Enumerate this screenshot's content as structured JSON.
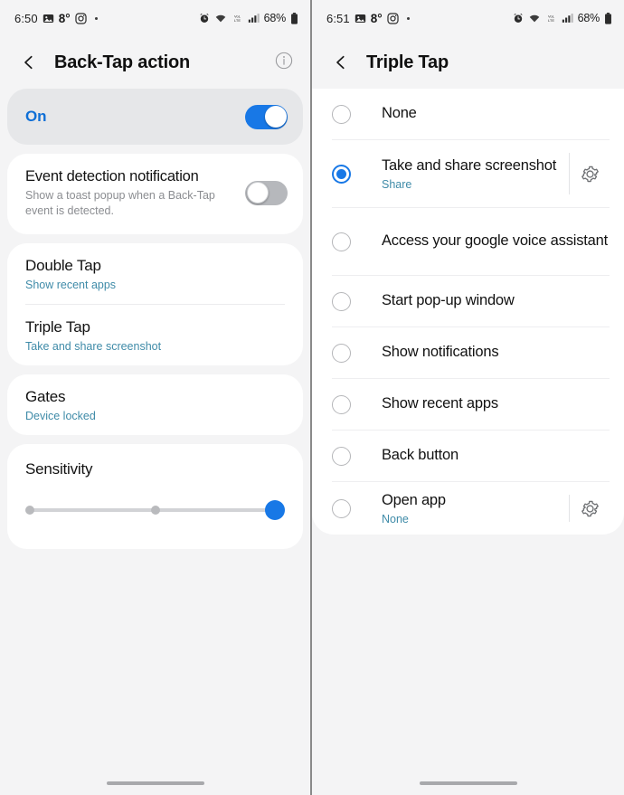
{
  "screens": [
    {
      "status_bar": {
        "time": "6:50",
        "temperature": "8°",
        "icons_left": [
          "photo-icon",
          "instagram-icon",
          "dot-indicator"
        ],
        "icons_right": [
          "alarm-icon",
          "wifi-icon",
          "volte-icon",
          "signal-icon"
        ],
        "battery_percent": "68%"
      },
      "app_bar": {
        "back_icon": "chevron-left-icon",
        "title": "Back-Tap action",
        "info_icon": "info-circle-icon"
      },
      "master_switch": {
        "label": "On",
        "state": "on"
      },
      "notification_row": {
        "title": "Event detection notification",
        "description": "Show a toast popup when a Back-Tap event is detected.",
        "state": "off"
      },
      "tap_actions": [
        {
          "title": "Double Tap",
          "value": "Show recent apps"
        },
        {
          "title": "Triple Tap",
          "value": "Take and share screenshot"
        }
      ],
      "gates": {
        "title": "Gates",
        "value": "Device locked"
      },
      "sensitivity": {
        "title": "Sensitivity",
        "steps": 3,
        "selected_index": 2
      },
      "gesture_bar": "home-gesture-bar"
    },
    {
      "status_bar": {
        "time": "6:51",
        "temperature": "8°",
        "icons_left": [
          "photo-icon",
          "instagram-icon",
          "dot-indicator"
        ],
        "icons_right": [
          "alarm-icon",
          "wifi-icon",
          "volte-icon",
          "signal-icon"
        ],
        "battery_percent": "68%"
      },
      "app_bar": {
        "back_icon": "chevron-left-icon",
        "title": "Triple Tap",
        "info_icon": null
      },
      "options": [
        {
          "label": "None",
          "sub": null,
          "selected": false,
          "gear": false
        },
        {
          "label": "Take and share screenshot",
          "sub": "Share",
          "selected": true,
          "gear": true
        },
        {
          "label": "Access your google voice assistant",
          "sub": null,
          "selected": false,
          "gear": false
        },
        {
          "label": "Start pop-up window",
          "sub": null,
          "selected": false,
          "gear": false
        },
        {
          "label": "Show notifications",
          "sub": null,
          "selected": false,
          "gear": false
        },
        {
          "label": "Show recent apps",
          "sub": null,
          "selected": false,
          "gear": false
        },
        {
          "label": "Back button",
          "sub": null,
          "selected": false,
          "gear": false
        },
        {
          "label": "Open app",
          "sub": "None",
          "selected": false,
          "gear": true
        }
      ],
      "gesture_bar": "home-gesture-bar"
    }
  ],
  "colors": {
    "accent_blue": "#1878e6",
    "link_teal": "#3f8ba8",
    "page_bg": "#f4f4f5",
    "card_bg": "#ffffff",
    "tinted_card_bg": "#e6e7e9"
  }
}
